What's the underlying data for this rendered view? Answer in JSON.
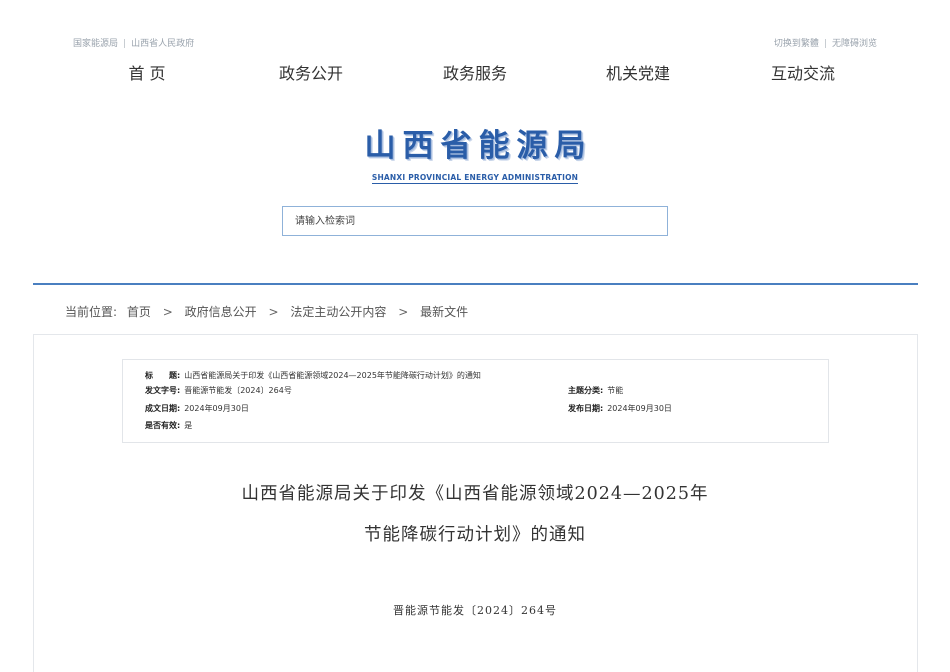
{
  "topbar": {
    "left_links": [
      "国家能源局",
      "山西省人民政府"
    ],
    "right_links": [
      "切换到繁體",
      "无障碍浏览"
    ],
    "separator": "|"
  },
  "nav": {
    "items": [
      "首 页",
      "政务公开",
      "政务服务",
      "机关党建",
      "互动交流"
    ]
  },
  "logo": {
    "cn": "山西省能源局",
    "en": "SHANXI PROVINCIAL ENERGY ADMINISTRATION"
  },
  "search": {
    "placeholder": "请输入检索词"
  },
  "breadcrumb": {
    "prefix": "当前位置:",
    "items": [
      "首页",
      "政府信息公开",
      "法定主动公开内容",
      "最新文件"
    ],
    "separator": ">"
  },
  "meta": {
    "title_key": "标　　题:",
    "title_value": "山西省能源局关于印发《山西省能源领域2024—2025年节能降碳行动计划》的通知",
    "doc_no_key": "发文字号:",
    "doc_no_value": "晋能源节能发〔2024〕264号",
    "topic_key": "主题分类:",
    "topic_value": "节能",
    "created_key": "成文日期:",
    "created_value": "2024年09月30日",
    "published_key": "发布日期:",
    "published_value": "2024年09月30日",
    "valid_key": "是否有效:",
    "valid_value": "是"
  },
  "document": {
    "title_line1": "山西省能源局关于印发《山西省能源领域2024—2025年",
    "title_line2": "节能降碳行动计划》的通知",
    "number": "晋能源节能发〔2024〕264号"
  },
  "colors": {
    "brand_blue": "#2a5da8",
    "divider_blue": "#4a7fc0"
  }
}
